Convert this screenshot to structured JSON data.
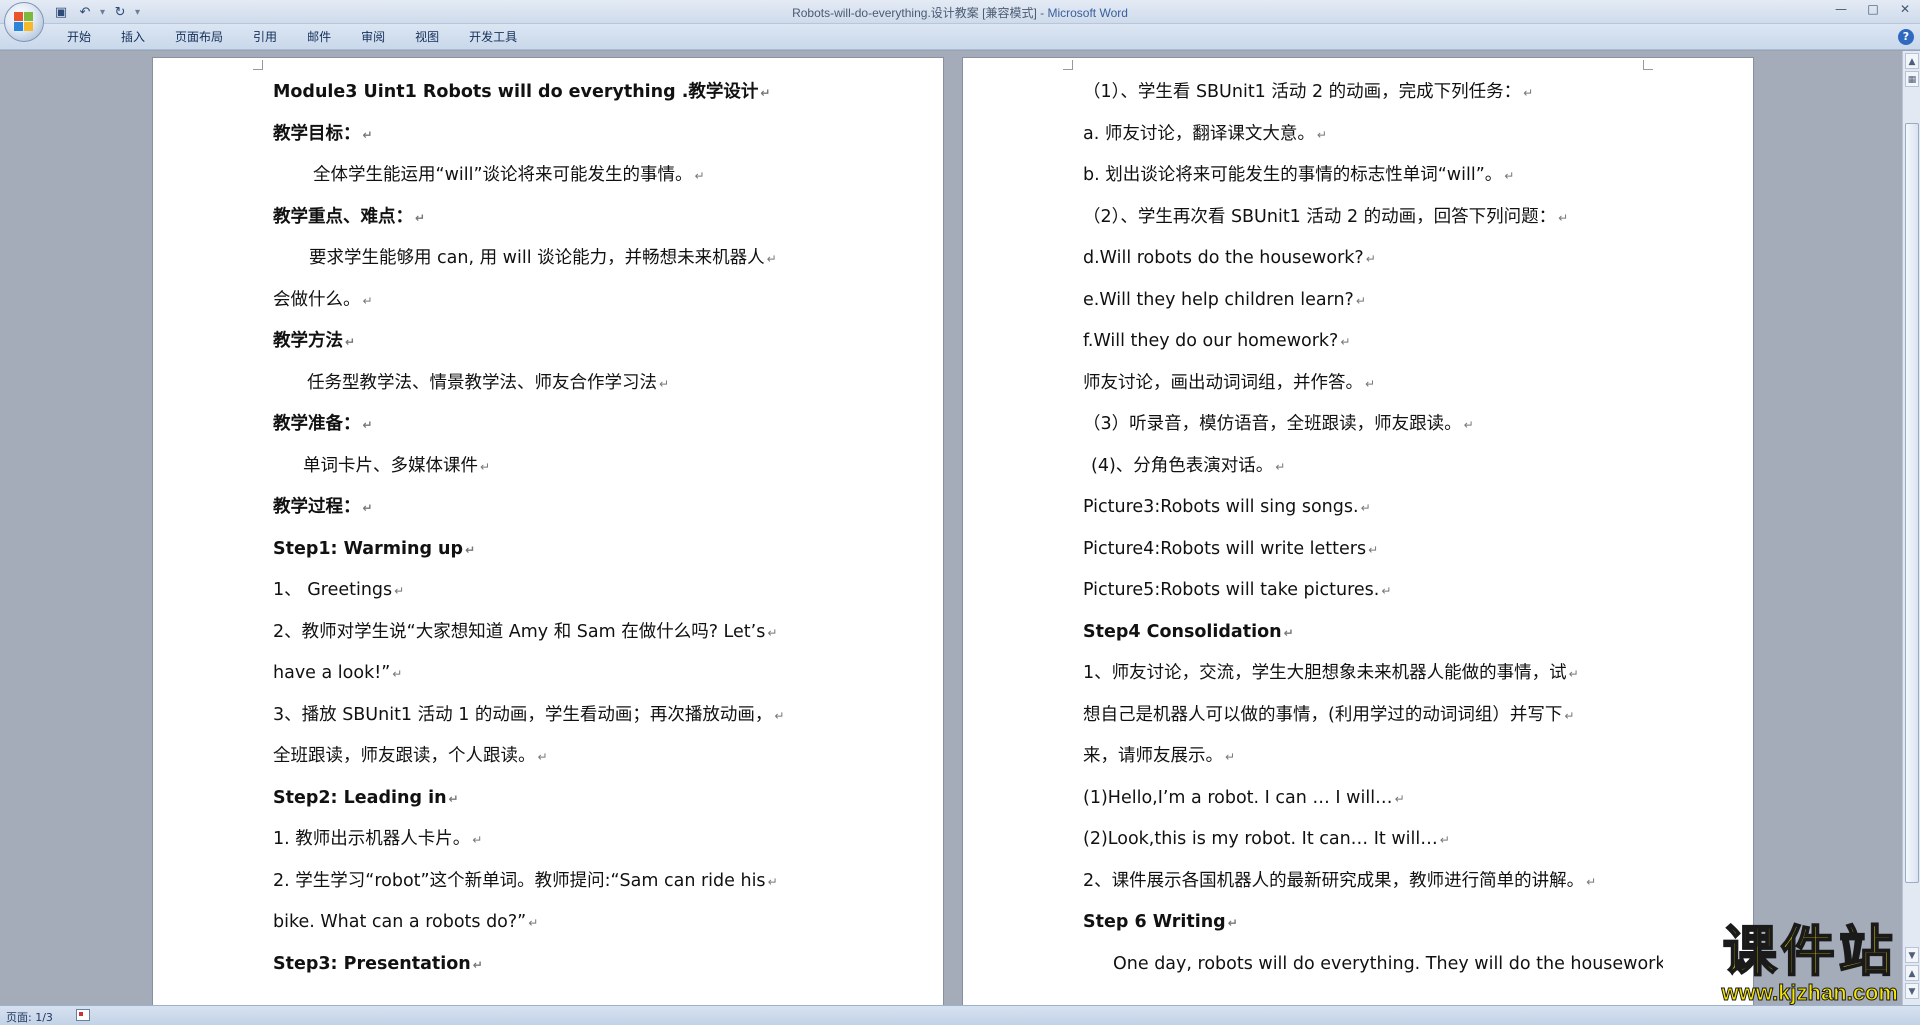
{
  "window": {
    "title": "Robots-will-do-everything.设计教案 [兼容模式]",
    "app_name": "Microsoft Word",
    "title_separator": " - "
  },
  "ribbon": {
    "tabs": [
      "开始",
      "插入",
      "页面布局",
      "引用",
      "邮件",
      "审阅",
      "视图",
      "开发工具"
    ]
  },
  "left_page": {
    "lines": [
      {
        "text": "Module3        Uint1  Robots  will  do  everything .教学设计",
        "bold": true,
        "indent": 0
      },
      {
        "text": "教学目标：",
        "bold": true,
        "indent": 0
      },
      {
        "text": "全体学生能运用“will”谈论将来可能发生的事情。",
        "bold": false,
        "indent": 40
      },
      {
        "text": "教学重点、难点：",
        "bold": true,
        "indent": 0
      },
      {
        "text": "要求学生能够用 can, 用 will 谈论能力，并畅想未来机器人",
        "bold": false,
        "indent": 36
      },
      {
        "text": "会做什么。",
        "bold": false,
        "indent": 0
      },
      {
        "text": "教学方法",
        "bold": true,
        "indent": 0
      },
      {
        "text": "任务型教学法、情景教学法、师友合作学习法",
        "bold": false,
        "indent": 34
      },
      {
        "text": "教学准备：",
        "bold": true,
        "indent": 0
      },
      {
        "text": "单词卡片、多媒体课件",
        "bold": false,
        "indent": 30
      },
      {
        "text": "教学过程：",
        "bold": true,
        "indent": 0
      },
      {
        "text": "Step1: Warming up",
        "bold": true,
        "indent": 0
      },
      {
        "text": "1、  Greetings",
        "bold": false,
        "indent": 0
      },
      {
        "text": "2、教师对学生说“大家想知道 Amy 和 Sam 在做什么吗? Let’s",
        "bold": false,
        "indent": 0
      },
      {
        "text": "have a look!”",
        "bold": false,
        "indent": 0
      },
      {
        "text": "3、播放 SBUnit1 活动 1 的动画，学生看动画；再次播放动画，",
        "bold": false,
        "indent": 0
      },
      {
        "text": "全班跟读，师友跟读，个人跟读。",
        "bold": false,
        "indent": 0
      },
      {
        "text": "Step2: Leading in",
        "bold": true,
        "indent": 0
      },
      {
        "text": "1.   教师出示机器人卡片。",
        "bold": false,
        "indent": 0
      },
      {
        "text": "2.   学生学习“robot”这个新单词。教师提问:“Sam can ride his",
        "bold": false,
        "indent": 0
      },
      {
        "text": "bike. What can a robots do?”",
        "bold": false,
        "indent": 0
      },
      {
        "text": "Step3: Presentation",
        "bold": true,
        "indent": 0
      }
    ]
  },
  "right_page": {
    "lines": [
      {
        "text": "（1）、学生看 SBUnit1 活动 2 的动画，完成下列任务：",
        "bold": false,
        "indent": 0
      },
      {
        "text": "a. 师友讨论，翻译课文大意。",
        "bold": false,
        "indent": 0
      },
      {
        "text": "b. 划出谈论将来可能发生的事情的标志性单词“will”。",
        "bold": false,
        "indent": 0
      },
      {
        "text": "（2）、学生再次看 SBUnit1 活动 2 的动画，回答下列问题：",
        "bold": false,
        "indent": 0
      },
      {
        "text": "d.Will robots do the housework?",
        "bold": false,
        "indent": 0
      },
      {
        "text": "e.Will they help children learn?",
        "bold": false,
        "indent": 0
      },
      {
        "text": "f.Will they do our homework?",
        "bold": false,
        "indent": 0
      },
      {
        "text": "师友讨论，画出动词词组，并作答。",
        "bold": false,
        "indent": 0
      },
      {
        "text": "（3）听录音，模仿语音，全班跟读，师友跟读。",
        "bold": false,
        "indent": 0
      },
      {
        "text": " (4)、分角色表演对话。",
        "bold": false,
        "indent": 8
      },
      {
        "text": "Picture3:Robots will sing songs.",
        "bold": false,
        "indent": 0
      },
      {
        "text": "Picture4:Robots will write letters",
        "bold": false,
        "indent": 0
      },
      {
        "text": "Picture5:Robots will take pictures.",
        "bold": false,
        "indent": 0
      },
      {
        "text": "Step4 Consolidation",
        "bold": true,
        "indent": 0
      },
      {
        "text": "1、师友讨论，交流，学生大胆想象未来机器人能做的事情，试",
        "bold": false,
        "indent": 0
      },
      {
        "text": "想自己是机器人可以做的事情，(利用学过的动词词组）并写下",
        "bold": false,
        "indent": 0
      },
      {
        "text": "来，请师友展示。",
        "bold": false,
        "indent": 0
      },
      {
        "text": "(1)Hello,I’m a robot. I can … I will…",
        "bold": false,
        "indent": 0
      },
      {
        "text": "(2)Look,this is my robot. It can… It will…",
        "bold": false,
        "indent": 0
      },
      {
        "text": "2、课件展示各国机器人的最新研究成果，教师进行简单的讲解。",
        "bold": false,
        "indent": 0
      },
      {
        "text": "Step 6 Writing",
        "bold": true,
        "indent": 0
      },
      {
        "text": "One day, robots will do everything. They will do the housework",
        "bold": false,
        "indent": 30
      }
    ]
  },
  "statusbar": {
    "page_info": "页面: 1/3"
  },
  "watermark": {
    "main": "课件站",
    "url": "www.kjzhan.com"
  }
}
